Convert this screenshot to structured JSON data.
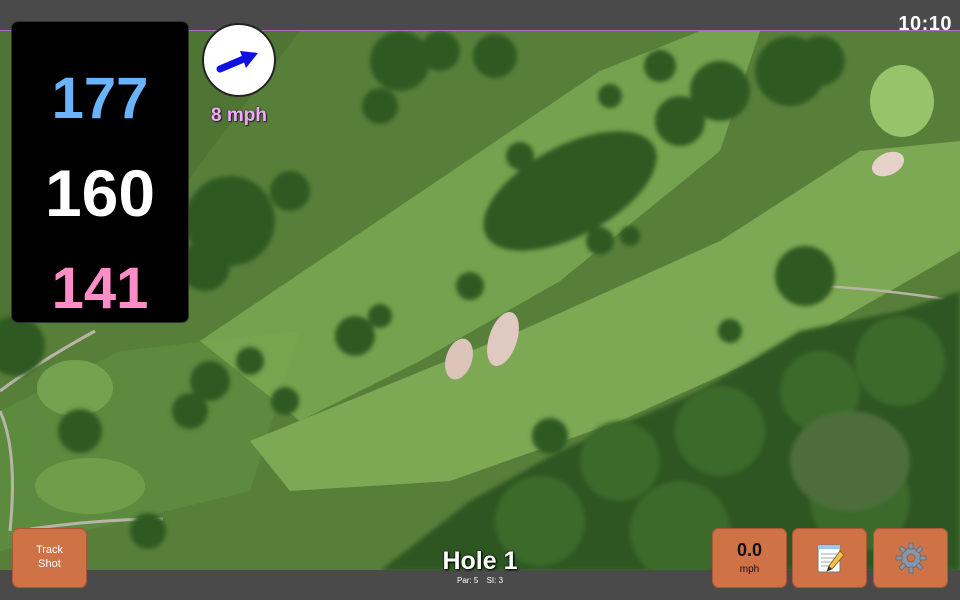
{
  "clock": "10:10",
  "distances": {
    "back": "177",
    "middle": "160",
    "front": "141"
  },
  "wind": {
    "icon": "arrow-icon",
    "speed_label": "8 mph",
    "arrow_color": "#1010e0"
  },
  "buttons": {
    "track_shot_line1": "Track",
    "track_shot_line2": "Shot",
    "wind_value": "0.0",
    "wind_unit": "mph",
    "notes_icon": "notepad-icon",
    "settings_icon": "gear-icon"
  },
  "hole": {
    "title": "Hole 1",
    "par": "Par: 5",
    "si": "SI: 3"
  },
  "colors": {
    "button": "#cf7245",
    "back": "#6ab4ff",
    "middle": "#ffffff",
    "front": "#ff8ec8",
    "wind_text": "#f4a8ff"
  }
}
